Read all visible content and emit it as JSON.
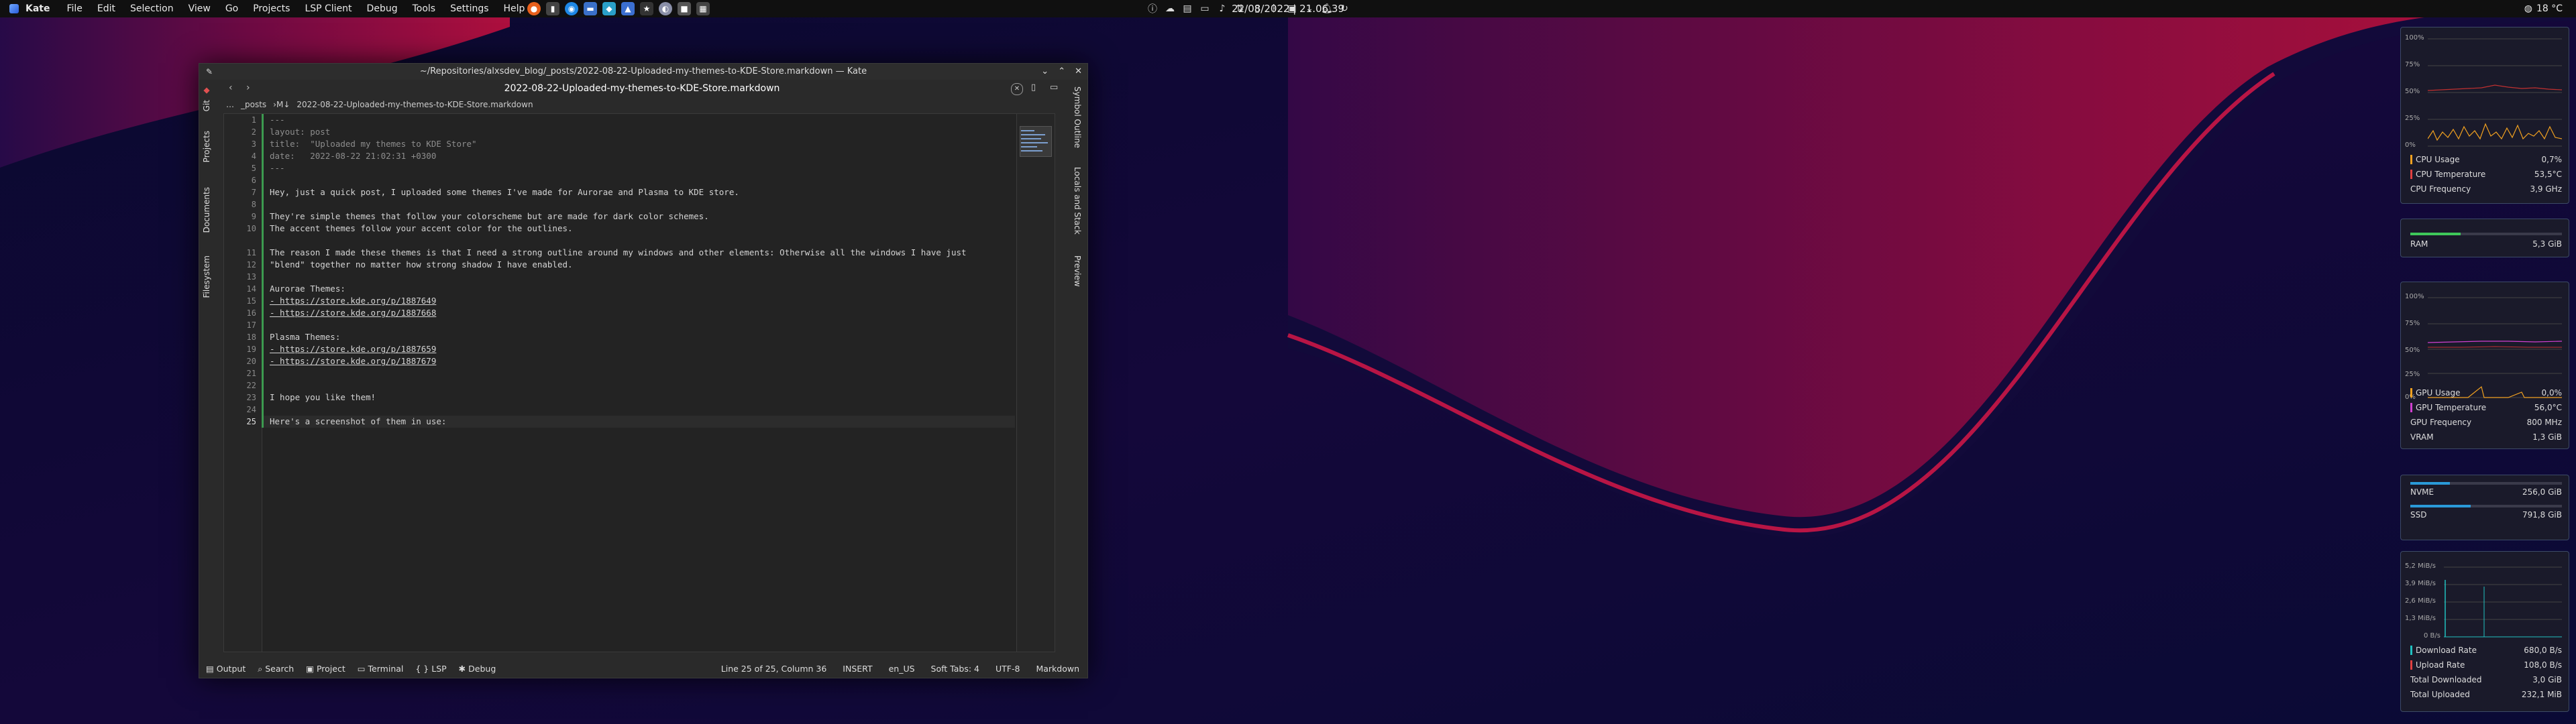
{
  "topbar": {
    "app_name": "Kate",
    "menu": [
      "File",
      "Edit",
      "Selection",
      "View",
      "Go",
      "Projects",
      "LSP Client",
      "Debug",
      "Tools",
      "Settings",
      "Help"
    ],
    "clock": "22/08/2022 | 21.06.39",
    "weather": "18 °C"
  },
  "window": {
    "title": "~/Repositories/alxsdev_blog/_posts/2022-08-22-Uploaded-my-themes-to-KDE-Store.markdown — Kate",
    "tab": "2022-08-22-Uploaded-my-themes-to-KDE-Store.markdown",
    "breadcrumb": [
      "_posts",
      "2022-08-22-Uploaded-my-themes-to-KDE-Store.markdown"
    ],
    "left_tabs": [
      "Git",
      "Projects",
      "Documents",
      "Filesystem"
    ],
    "right_tabs": [
      "Symbol Outline",
      "Locals and Stack",
      "Preview"
    ]
  },
  "editor": {
    "current_line": 25,
    "lines": [
      "---",
      "layout: post",
      "title:  \"Uploaded my themes to KDE Store\"",
      "date:   2022-08-22 21:02:31 +0300",
      "---",
      "",
      "Hey, just a quick post, I uploaded some themes I've made for Aurorae and Plasma to KDE store.",
      "",
      "They're simple themes that follow your colorscheme but are made for dark color schemes.",
      "The accent themes follow your accent color for the outlines.",
      "",
      "The reason I made these themes is that I need a strong outline around my windows and other elements: Otherwise all the windows I have just",
      "\"blend\" together no matter how strong shadow I have enabled.",
      "",
      "Aurorae Themes:",
      "- https://store.kde.org/p/1887649",
      "- https://store.kde.org/p/1887668",
      "",
      "Plasma Themes:",
      "- https://store.kde.org/p/1887659",
      "- https://store.kde.org/p/1887679",
      "",
      "",
      "I hope you like them!",
      "",
      "Here's a screenshot of them in use:"
    ],
    "line_numbers": [
      "1",
      "2",
      "3",
      "4",
      "5",
      "6",
      "7",
      "8",
      "9",
      "10",
      "",
      "11",
      "12",
      "13",
      "14",
      "15",
      "16",
      "17",
      "18",
      "19",
      "20",
      "21",
      "22",
      "23",
      "24",
      "25"
    ]
  },
  "statusbar": {
    "left": [
      "Output",
      "Search",
      "Project",
      "Terminal",
      "LSP",
      "Debug"
    ],
    "position": "Line 25 of 25, Column 36",
    "mode": "INSERT",
    "lang": "en_US",
    "tabs": "Soft Tabs: 4",
    "encoding": "UTF-8",
    "syntax": "Markdown"
  },
  "widgets": {
    "cpu": {
      "ticks": [
        "100%",
        "75%",
        "50%",
        "25%",
        "0%"
      ],
      "rows": [
        {
          "label": "CPU Usage",
          "value": "0,7%",
          "color": "#f0a020"
        },
        {
          "label": "CPU Temperature",
          "value": "53,5°C",
          "color": "#e04040"
        },
        {
          "label": "CPU Frequency",
          "value": "3,9 GHz",
          "color": ""
        }
      ]
    },
    "ram": {
      "label": "RAM",
      "value": "5,3 GiB",
      "fill": 0.33
    },
    "gpu": {
      "ticks": [
        "100%",
        "75%",
        "50%",
        "25%",
        "0%"
      ],
      "rows": [
        {
          "label": "GPU Usage",
          "value": "0,0%",
          "color": "#f0a020"
        },
        {
          "label": "GPU Temperature",
          "value": "56,0°C",
          "color": "#d040d0"
        },
        {
          "label": "GPU Frequency",
          "value": "800 MHz",
          "color": ""
        },
        {
          "label": "VRAM",
          "value": "1,3 GiB",
          "color": ""
        }
      ]
    },
    "disks": [
      {
        "label": "NVME",
        "value": "256,0 GiB",
        "fill": 0.26
      },
      {
        "label": "SSD",
        "value": "791,8 GiB",
        "fill": 0.4
      }
    ],
    "net": {
      "ticks": [
        "5,2 MiB/s",
        "3,9 MiB/s",
        "2,6 MiB/s",
        "1,3 MiB/s",
        "0 B/s"
      ],
      "rows": [
        {
          "label": "Download Rate",
          "value": "680,0 B/s",
          "color": "#20c0c0"
        },
        {
          "label": "Upload Rate",
          "value": "108,0 B/s",
          "color": "#e04040"
        },
        {
          "label": "Total Downloaded",
          "value": "3,0 GiB",
          "color": ""
        },
        {
          "label": "Total Uploaded",
          "value": "232,1 MiB",
          "color": ""
        }
      ]
    }
  }
}
